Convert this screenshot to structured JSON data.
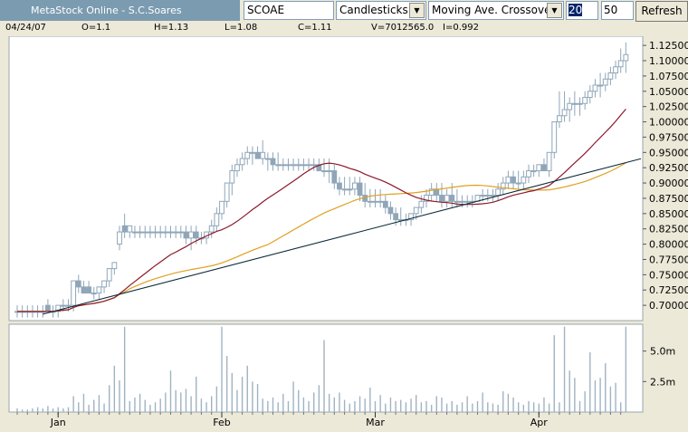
{
  "toolbar": {
    "title": "MetaStock Online - S.C.Soares",
    "symbol": "SCOAE",
    "chart_type": "Candlesticks",
    "indicator": "Moving Ave. Crossover",
    "period_fast": "20",
    "period_slow": "50",
    "refresh_label": "Refresh"
  },
  "info": {
    "date": "04/24/07",
    "open": "O=1.1",
    "high": "H=1.13",
    "low": "L=1.08",
    "close": "C=1.11",
    "volume": "V=7012565.0",
    "indicator": "I=0.992"
  },
  "colors": {
    "candle": "#8fa6b8",
    "ma_fast": "#8b1a2b",
    "ma_slow": "#e0a020",
    "trendline": "#0c2a3a",
    "volume": "#a0b3c2"
  },
  "chart_data": {
    "type": "candlestick",
    "title": "",
    "price_axis": {
      "range": [
        0.675,
        1.14
      ],
      "ticks": [
        "1.12500",
        "1.10000",
        "1.07500",
        "1.05000",
        "1.02500",
        "1.00000",
        "0.97500",
        "0.95000",
        "0.92500",
        "0.90000",
        "0.87500",
        "0.85000",
        "0.82500",
        "0.80000",
        "0.77500",
        "0.75000",
        "0.72500",
        "0.70000"
      ]
    },
    "volume_axis": {
      "range": [
        0,
        7.2
      ],
      "ticks": [
        "5.0m",
        "2.5m"
      ],
      "unit": "m"
    },
    "x_ticks": [
      {
        "label": "Jan",
        "index": 8
      },
      {
        "label": "Feb",
        "index": 40
      },
      {
        "label": "Mar",
        "index": 70
      },
      {
        "label": "Apr",
        "index": 102
      }
    ],
    "candles": {
      "open": [
        0.69,
        0.69,
        0.69,
        0.69,
        0.69,
        0.69,
        0.7,
        0.69,
        0.69,
        0.7,
        0.7,
        0.7,
        0.74,
        0.73,
        0.73,
        0.72,
        0.72,
        0.73,
        0.74,
        0.76,
        0.8,
        0.83,
        0.82,
        0.82,
        0.82,
        0.82,
        0.82,
        0.82,
        0.82,
        0.82,
        0.82,
        0.82,
        0.82,
        0.82,
        0.81,
        0.82,
        0.81,
        0.81,
        0.82,
        0.83,
        0.85,
        0.87,
        0.9,
        0.92,
        0.93,
        0.94,
        0.95,
        0.95,
        0.94,
        0.94,
        0.94,
        0.93,
        0.93,
        0.93,
        0.93,
        0.93,
        0.93,
        0.93,
        0.93,
        0.93,
        0.92,
        0.92,
        0.92,
        0.9,
        0.89,
        0.89,
        0.89,
        0.9,
        0.88,
        0.87,
        0.87,
        0.87,
        0.87,
        0.86,
        0.85,
        0.84,
        0.84,
        0.84,
        0.85,
        0.86,
        0.87,
        0.88,
        0.89,
        0.88,
        0.87,
        0.88,
        0.87,
        0.87,
        0.87,
        0.87,
        0.87,
        0.88,
        0.88,
        0.88,
        0.88,
        0.89,
        0.9,
        0.91,
        0.9,
        0.9,
        0.91,
        0.92,
        0.92,
        0.93,
        0.92,
        0.95,
        1.0,
        1.01,
        1.02,
        1.03,
        1.03,
        1.03,
        1.04,
        1.05,
        1.06,
        1.06,
        1.07,
        1.08,
        1.09,
        1.1
      ],
      "high": [
        0.7,
        0.7,
        0.7,
        0.7,
        0.7,
        0.7,
        0.71,
        0.7,
        0.7,
        0.71,
        0.71,
        0.71,
        0.75,
        0.74,
        0.74,
        0.73,
        0.73,
        0.74,
        0.76,
        0.77,
        0.83,
        0.85,
        0.83,
        0.83,
        0.83,
        0.83,
        0.83,
        0.83,
        0.83,
        0.83,
        0.83,
        0.83,
        0.83,
        0.83,
        0.83,
        0.83,
        0.82,
        0.82,
        0.84,
        0.86,
        0.87,
        0.9,
        0.93,
        0.94,
        0.95,
        0.96,
        0.96,
        0.96,
        0.97,
        0.95,
        0.95,
        0.95,
        0.94,
        0.94,
        0.94,
        0.94,
        0.94,
        0.94,
        0.94,
        0.94,
        0.94,
        0.94,
        0.93,
        0.91,
        0.91,
        0.91,
        0.91,
        0.91,
        0.9,
        0.89,
        0.89,
        0.89,
        0.88,
        0.87,
        0.86,
        0.86,
        0.85,
        0.85,
        0.86,
        0.88,
        0.89,
        0.9,
        0.9,
        0.9,
        0.89,
        0.9,
        0.89,
        0.88,
        0.88,
        0.88,
        0.88,
        0.89,
        0.89,
        0.89,
        0.9,
        0.91,
        0.92,
        0.92,
        0.92,
        0.92,
        0.93,
        0.93,
        0.93,
        0.94,
        0.94,
        1.0,
        1.05,
        1.05,
        1.04,
        1.05,
        1.04,
        1.05,
        1.06,
        1.07,
        1.08,
        1.08,
        1.09,
        1.1,
        1.12,
        1.13
      ],
      "low": [
        0.68,
        0.68,
        0.68,
        0.68,
        0.68,
        0.68,
        0.69,
        0.68,
        0.68,
        0.69,
        0.69,
        0.69,
        0.72,
        0.72,
        0.72,
        0.71,
        0.71,
        0.72,
        0.73,
        0.75,
        0.79,
        0.81,
        0.81,
        0.81,
        0.81,
        0.81,
        0.81,
        0.81,
        0.81,
        0.81,
        0.81,
        0.81,
        0.81,
        0.8,
        0.79,
        0.8,
        0.8,
        0.8,
        0.81,
        0.82,
        0.84,
        0.86,
        0.88,
        0.91,
        0.92,
        0.93,
        0.93,
        0.94,
        0.93,
        0.92,
        0.92,
        0.92,
        0.92,
        0.92,
        0.92,
        0.92,
        0.92,
        0.92,
        0.92,
        0.92,
        0.91,
        0.9,
        0.89,
        0.88,
        0.88,
        0.88,
        0.88,
        0.87,
        0.86,
        0.86,
        0.86,
        0.86,
        0.85,
        0.84,
        0.83,
        0.83,
        0.83,
        0.83,
        0.84,
        0.85,
        0.86,
        0.87,
        0.87,
        0.86,
        0.86,
        0.86,
        0.86,
        0.86,
        0.86,
        0.86,
        0.87,
        0.87,
        0.87,
        0.87,
        0.87,
        0.88,
        0.89,
        0.89,
        0.89,
        0.89,
        0.9,
        0.91,
        0.91,
        0.92,
        0.91,
        0.94,
        0.99,
        1.0,
        1.0,
        1.01,
        1.01,
        1.02,
        1.03,
        1.04,
        1.04,
        1.05,
        1.06,
        1.07,
        1.08,
        1.08
      ],
      "close": [
        0.69,
        0.69,
        0.69,
        0.69,
        0.69,
        0.69,
        0.69,
        0.69,
        0.7,
        0.7,
        0.7,
        0.74,
        0.73,
        0.72,
        0.72,
        0.72,
        0.73,
        0.74,
        0.76,
        0.77,
        0.82,
        0.82,
        0.83,
        0.82,
        0.82,
        0.82,
        0.82,
        0.82,
        0.82,
        0.82,
        0.82,
        0.82,
        0.82,
        0.81,
        0.82,
        0.81,
        0.81,
        0.82,
        0.83,
        0.85,
        0.87,
        0.9,
        0.92,
        0.93,
        0.94,
        0.95,
        0.95,
        0.94,
        0.95,
        0.94,
        0.93,
        0.93,
        0.93,
        0.93,
        0.93,
        0.93,
        0.93,
        0.93,
        0.93,
        0.92,
        0.92,
        0.92,
        0.9,
        0.89,
        0.89,
        0.89,
        0.9,
        0.88,
        0.87,
        0.87,
        0.87,
        0.87,
        0.86,
        0.85,
        0.84,
        0.84,
        0.84,
        0.85,
        0.86,
        0.87,
        0.88,
        0.89,
        0.88,
        0.87,
        0.88,
        0.87,
        0.87,
        0.87,
        0.87,
        0.87,
        0.88,
        0.88,
        0.88,
        0.88,
        0.89,
        0.9,
        0.91,
        0.9,
        0.9,
        0.91,
        0.92,
        0.92,
        0.93,
        0.92,
        0.95,
        1.0,
        1.01,
        1.02,
        1.03,
        1.03,
        1.03,
        1.04,
        1.05,
        1.06,
        1.06,
        1.07,
        1.08,
        1.09,
        1.1,
        1.11
      ],
      "volume": [
        0.3,
        0.2,
        0.2,
        0.3,
        0.4,
        0.3,
        0.5,
        0.3,
        0.4,
        0.3,
        0.4,
        1.3,
        0.8,
        1.5,
        0.6,
        1.0,
        1.4,
        0.7,
        2.2,
        3.8,
        2.6,
        7.0,
        0.9,
        1.2,
        1.5,
        1.0,
        0.6,
        0.8,
        1.1,
        1.6,
        3.4,
        1.8,
        1.6,
        1.9,
        1.3,
        2.9,
        1.1,
        0.8,
        1.3,
        2.1,
        7.0,
        4.6,
        3.2,
        1.8,
        2.9,
        3.8,
        2.5,
        2.3,
        1.1,
        0.9,
        1.2,
        0.8,
        1.5,
        0.9,
        2.5,
        1.8,
        1.2,
        0.9,
        1.6,
        2.2,
        5.9,
        1.5,
        1.2,
        1.6,
        1.0,
        0.7,
        0.9,
        1.3,
        1.1,
        2.0,
        0.9,
        1.4,
        0.7,
        1.2,
        0.9,
        1.0,
        0.8,
        1.1,
        1.4,
        0.8,
        0.9,
        0.6,
        1.3,
        1.2,
        0.7,
        0.9,
        0.6,
        0.8,
        1.3,
        0.7,
        0.9,
        1.6,
        0.8,
        0.7,
        0.6,
        1.7,
        1.5,
        1.2,
        0.8,
        0.6,
        0.9,
        0.8,
        0.7,
        1.2,
        0.7,
        6.3,
        0.8,
        7.0,
        3.4,
        2.8,
        0.9,
        1.7,
        4.9,
        2.6,
        2.8,
        4.0,
        2.1,
        2.4,
        0.8,
        7.0
      ]
    },
    "ma_fast_label": "20",
    "ma_slow_label": "50",
    "trendline": {
      "from": {
        "index": 5,
        "price": 0.6855
      },
      "to": {
        "index": 120,
        "price": 0.9355
      }
    },
    "grid": false
  }
}
